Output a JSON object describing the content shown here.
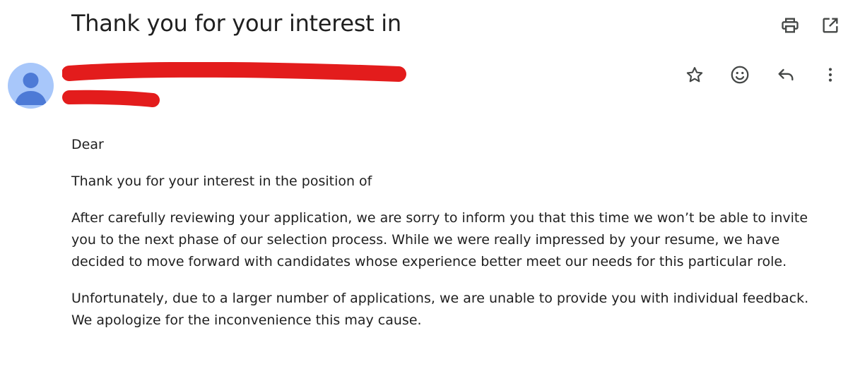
{
  "email": {
    "subject": "Thank you for your interest in",
    "toolbar": {
      "print_icon": "printer-icon",
      "open_new_window_icon": "open-in-new-icon"
    },
    "sender_actions": {
      "star_icon": "star-icon",
      "react_icon": "emoji-icon",
      "reply_icon": "reply-icon",
      "more_icon": "more-vert-icon"
    },
    "avatar_icon": "person-icon",
    "redaction_color": "#e31c1c",
    "avatar_color": "#a8c7fa",
    "avatar_figure_color": "#4d7ad6",
    "body": {
      "greeting": "Dear",
      "paragraph_1": "Thank you for your interest in the position of",
      "paragraph_2": "After carefully reviewing your application, we are sorry to inform you that this time we won’t be able to invite you to the next phase of our selection process. While we were really impressed by your resume, we have decided to move forward with candidates whose experience better meet our needs for this particular role.",
      "paragraph_3": "Unfortunately, due to a larger number of applications, we are unable to provide you with individual feedback. We apologize for the inconvenience this may cause."
    }
  }
}
